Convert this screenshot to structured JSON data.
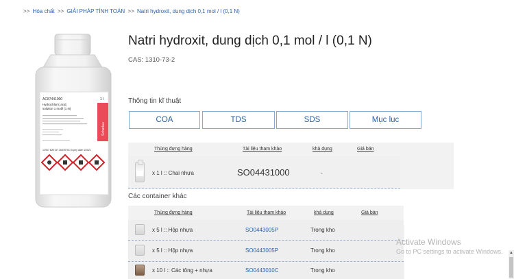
{
  "breadcrumb": {
    "sep": ">>",
    "items": [
      "Hóa chất",
      "GIẢI PHÁP TÍNH TOÁN",
      "Natri hydroxit, dung dịch 0,1 mol / l (0,1 N)"
    ]
  },
  "product": {
    "title": "Natri hydroxit, dung dịch 0,1 mol / l (0,1 N)",
    "cas": "CAS: 1310-73-2",
    "image_label": {
      "code": "AC87441000",
      "size": "1 l",
      "name_line1": "Hydrochloric acid,",
      "name_line2": "solution 1 mol/l (1 N)",
      "brand": "Scharlau",
      "batch": "12907 BATCH 16878701  Expiry date 4/2021"
    }
  },
  "tech": {
    "label": "Thông tin kĩ thuật",
    "buttons": [
      "COA",
      "TDS",
      "SDS",
      "Mục lục"
    ]
  },
  "main_table": {
    "headers": [
      "Thùng đựng hàng",
      "Tài liệu tham khảo",
      "khả dụng",
      "Giá bán"
    ],
    "row": {
      "container": "x 1 l :: Chai nhựa",
      "ref": "SO04431000",
      "availability": "-"
    }
  },
  "other": {
    "label": "Các container khác",
    "headers": [
      "Thùng đựng hàng",
      "Tài liệu tham khảo",
      "khả dụng",
      "Giá bán"
    ],
    "rows": [
      {
        "container": "x 5 l :: Hộp nhựa",
        "ref": "SO0443005P",
        "availability": "Trong kho"
      },
      {
        "container": "x 5 l :: Hộp nhựa",
        "ref": "SO0443005P",
        "availability": "Trong kho"
      },
      {
        "container": "x 10 l :: Các tông + nhựa",
        "ref": "SO0443010C",
        "availability": "Trong kho"
      }
    ]
  },
  "watermark": {
    "title": "Activate Windows",
    "subtitle": "Go to PC settings to activate Windows."
  }
}
